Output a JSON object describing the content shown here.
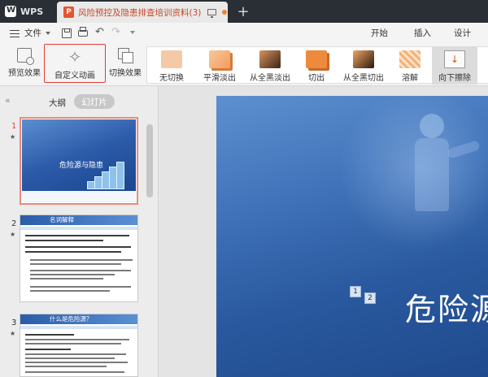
{
  "titlebar": {
    "app_tab": "WPS",
    "doc_icon": "P",
    "doc_title": "风险预控及隐患排查培训资料(3)",
    "icons": [
      "wps-logo-icon",
      "ppt-file-icon",
      "monitor-icon",
      "unsaved-dot-icon",
      "plus-icon"
    ]
  },
  "menubar": {
    "file_label": "文件",
    "tabs": [
      "开始",
      "插入",
      "设计"
    ]
  },
  "ribbon": {
    "preview_label": "预览效果",
    "custom_animation_label": "自定义动画",
    "switch_effect_label": "切换效果",
    "transitions": [
      {
        "label": "无切换",
        "color": "#f6c9a6"
      },
      {
        "label": "平滑淡出",
        "color": "#f29d5b"
      },
      {
        "label": "从全黑淡出",
        "color": "#7a4a2c"
      },
      {
        "label": "切出",
        "color": "#ee8a3c"
      },
      {
        "label": "从全黑切出",
        "color": "#8a4b22"
      },
      {
        "label": "溶解",
        "color": "#f2b27a"
      },
      {
        "label": "向下擦除",
        "color": "#fafafa"
      }
    ],
    "highlight_color": "#e23b30"
  },
  "leftpanel": {
    "outline_label": "大纲",
    "slides_label": "幻灯片",
    "slides": [
      {
        "number": "1",
        "title": "危险源与隐患"
      },
      {
        "number": "2",
        "title": "名词解释"
      },
      {
        "number": "3",
        "title": "什么是危险源？"
      }
    ]
  },
  "canvas": {
    "slide_title": "危险源",
    "animation_tags": [
      "1",
      "2"
    ]
  }
}
